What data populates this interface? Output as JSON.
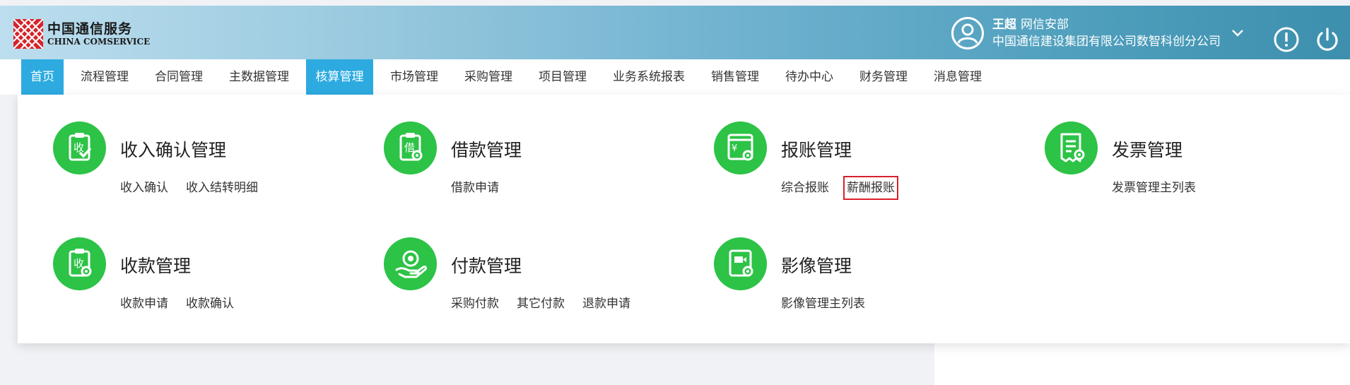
{
  "header": {
    "logo_cn": "中国通信服务",
    "logo_en": "CHINA COMSERVICE",
    "user_name": "王超",
    "user_dept": "网信安部",
    "user_company": "中国通信建设集团有限公司数智科创分公司"
  },
  "nav": {
    "items": [
      "首页",
      "流程管理",
      "合同管理",
      "主数据管理",
      "核算管理",
      "市场管理",
      "采购管理",
      "项目管理",
      "业务系统报表",
      "销售管理",
      "待办中心",
      "财务管理",
      "消息管理"
    ],
    "active": [
      "首页",
      "核算管理"
    ]
  },
  "menu": {
    "modules": [
      {
        "title": "收入确认管理",
        "icon": "income-confirm-icon",
        "icon_char": "收",
        "links": [
          "收入确认",
          "收入结转明细"
        ]
      },
      {
        "title": "借款管理",
        "icon": "loan-icon",
        "icon_char": "借",
        "links": [
          "借款申请"
        ]
      },
      {
        "title": "报账管理",
        "icon": "reimbursement-icon",
        "icon_char": "¥",
        "links": [
          "综合报账",
          "薪酬报账"
        ]
      },
      {
        "title": "发票管理",
        "icon": "invoice-icon",
        "icon_char": "",
        "links": [
          "发票管理主列表"
        ]
      },
      {
        "title": "收款管理",
        "icon": "receipt-icon",
        "icon_char": "收",
        "links": [
          "收款申请",
          "收款确认"
        ]
      },
      {
        "title": "付款管理",
        "icon": "payment-icon",
        "icon_char": "",
        "links": [
          "采购付款",
          "其它付款",
          "退款申请"
        ]
      },
      {
        "title": "影像管理",
        "icon": "image-icon",
        "icon_char": "",
        "links": [
          "影像管理主列表"
        ]
      }
    ],
    "highlighted_link": "薪酬报账"
  },
  "colors": {
    "accent": "#2dabe1",
    "module_icon": "#2cc346",
    "highlight_box": "#d9212a",
    "logo_red": "#d8232a"
  }
}
